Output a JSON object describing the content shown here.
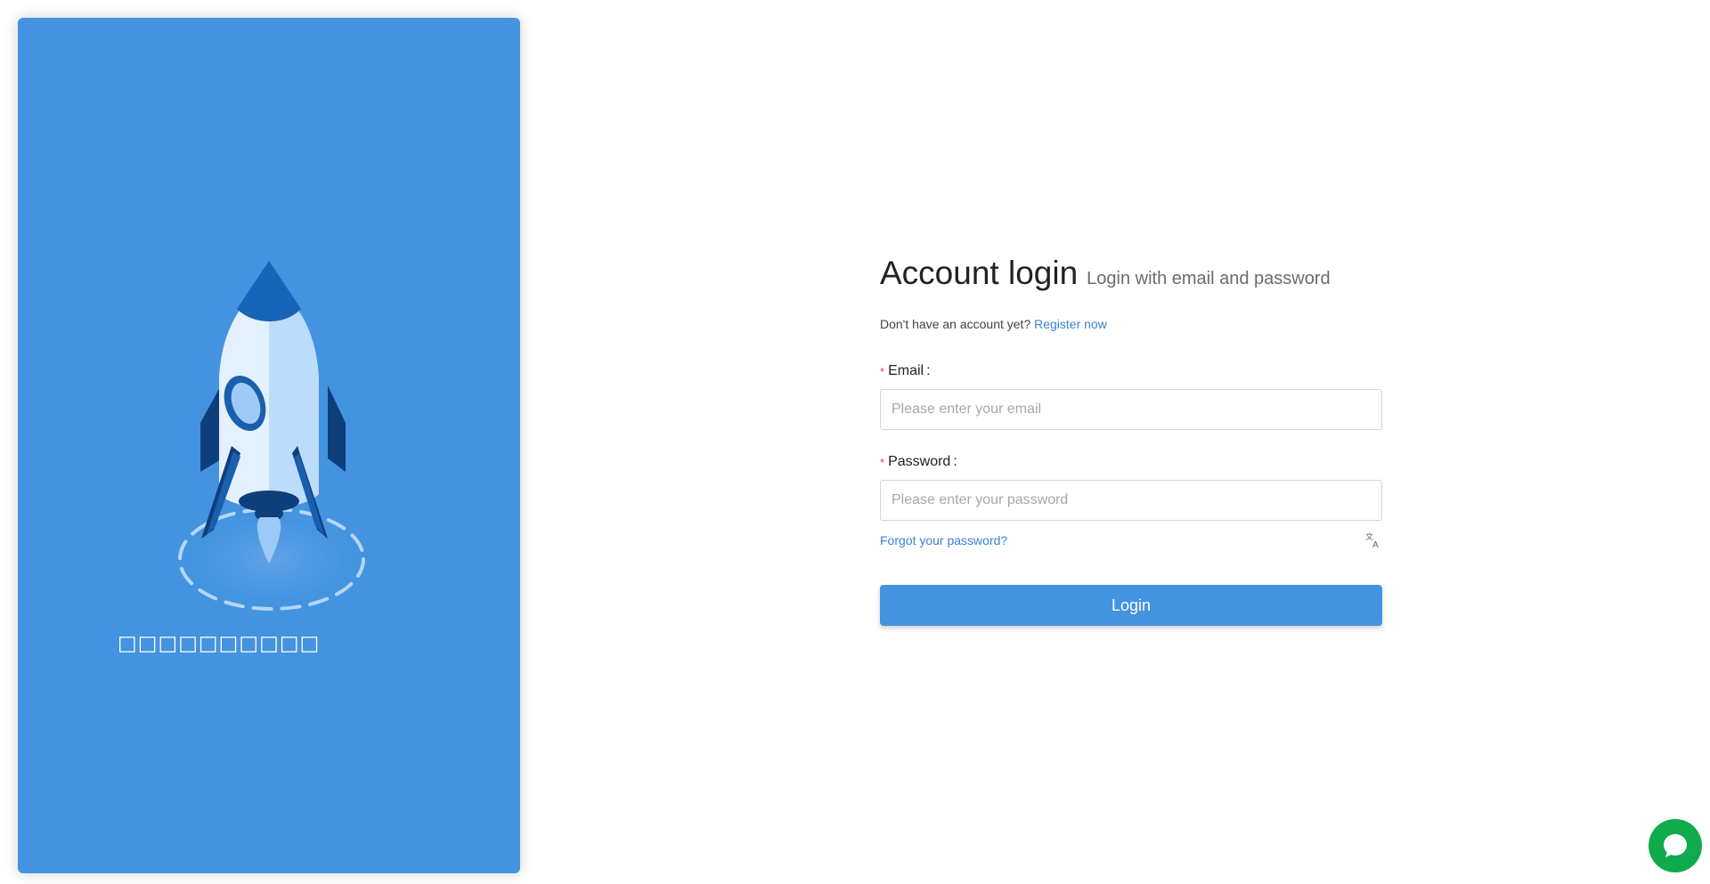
{
  "left_panel": {
    "caption": "□□□□□□□□□□",
    "background_color": "#4493e0",
    "illustration_icon": "rocket-icon"
  },
  "login": {
    "title": "Account login",
    "subtitle": "Login with email and password",
    "register_prompt": "Don't have an account yet?",
    "register_link": "Register now",
    "email_label": "Email",
    "email_placeholder": "Please enter your email",
    "password_label": "Password",
    "password_placeholder": "Please enter your password",
    "forgot_link": "Forgot your password?",
    "translate_icon": "translate-icon",
    "submit_label": "Login",
    "accent_color": "#4493e0",
    "required_color": "#e5484d"
  },
  "chat_widget": {
    "icon": "chat-bubble-icon",
    "color": "#0fab4c"
  }
}
